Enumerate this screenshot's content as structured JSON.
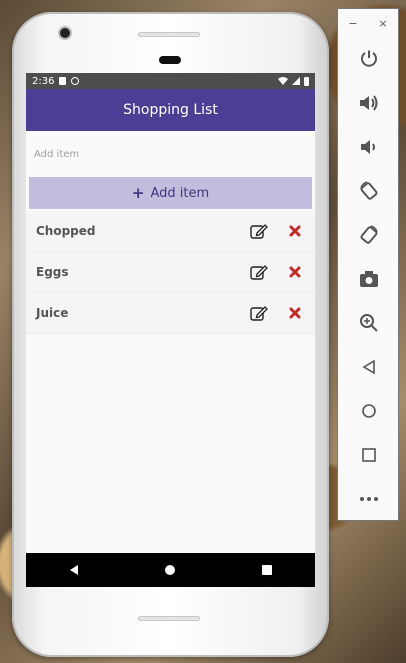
{
  "status_bar": {
    "time": "2:36"
  },
  "app": {
    "title": "Shopping List"
  },
  "input": {
    "placeholder": "Add item",
    "value": ""
  },
  "add_button": {
    "label": "Add item"
  },
  "items": [
    {
      "label": "Chopped"
    },
    {
      "label": "Eggs"
    },
    {
      "label": "Juice"
    }
  ],
  "colors": {
    "app_bar": "#4a3f94",
    "add_button_bg": "#c2bcdd",
    "delete": "#c62828"
  },
  "emulator_panel": {
    "minimize": "−",
    "close": "×",
    "buttons": [
      "power-icon",
      "volume-up-icon",
      "volume-down-icon",
      "rotate-left-icon",
      "rotate-right-icon",
      "camera-icon",
      "zoom-icon",
      "back-icon",
      "home-icon",
      "overview-icon",
      "more-icon"
    ]
  }
}
